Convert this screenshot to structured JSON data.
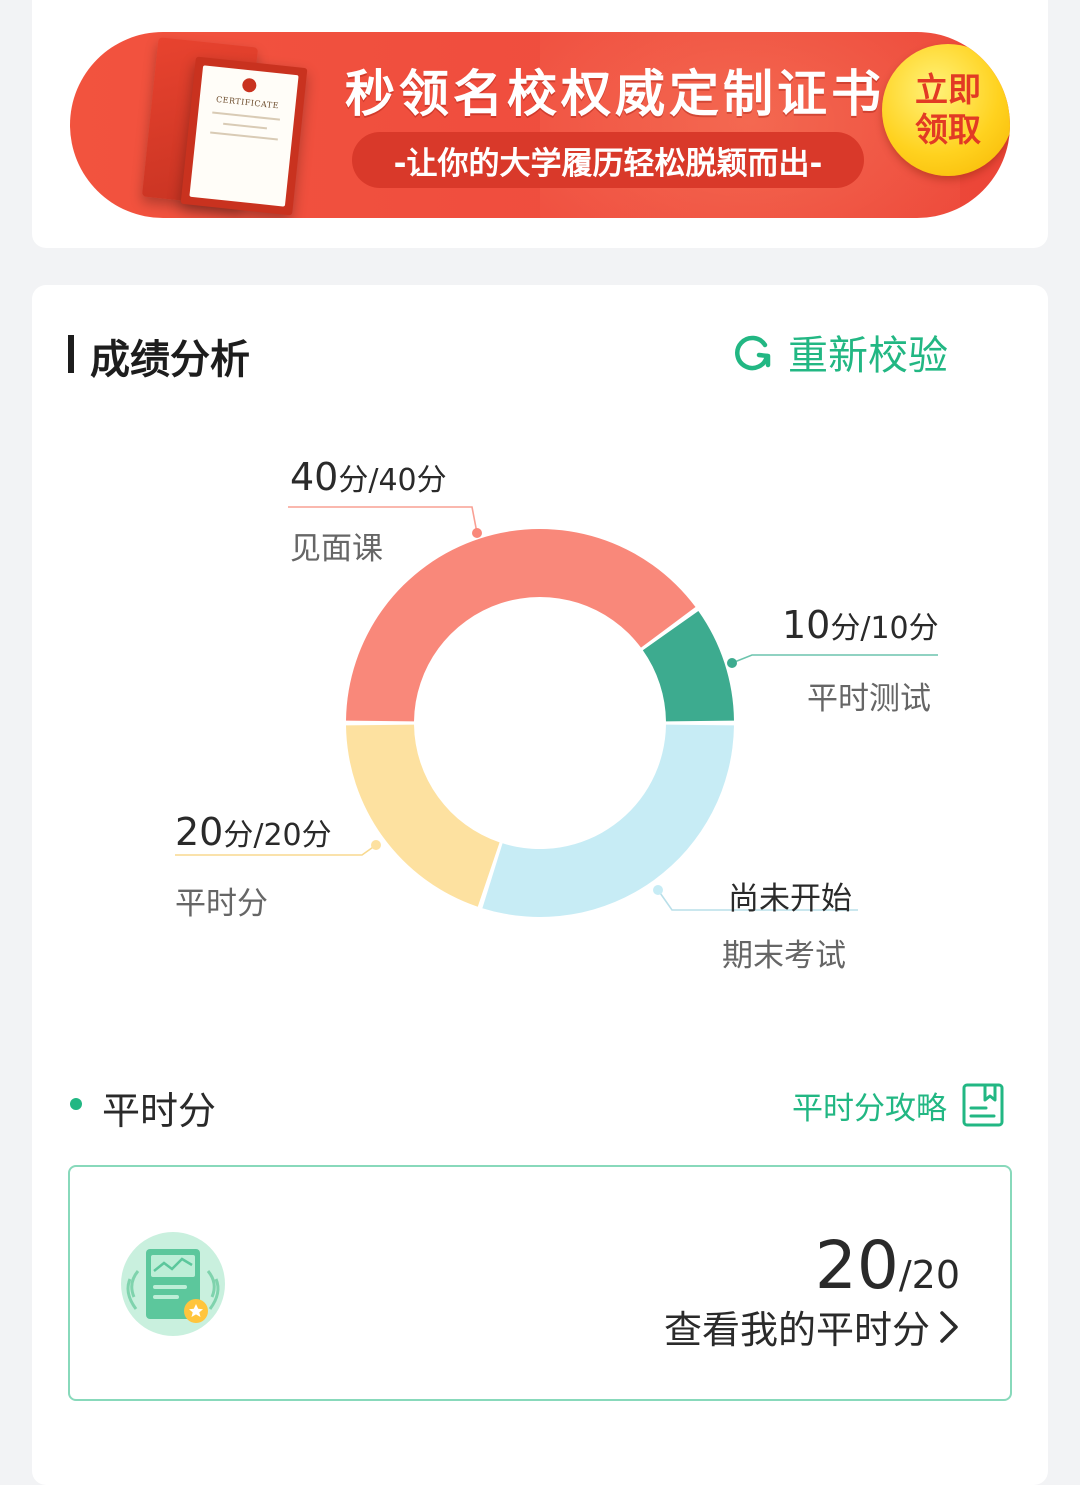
{
  "banner": {
    "title": "秒领名校权威定制证书",
    "subtitle": "-让你的大学履历轻松脱颖而出-",
    "claim_line1": "立即",
    "claim_line2": "领取",
    "certificate_text": "CERTIFICATE"
  },
  "score_section": {
    "title": "成绩分析",
    "reverify_label": "重新校验",
    "colors": {
      "accent": "#22b783",
      "face_to_face": "#f9887a",
      "quiz": "#3dab8f",
      "final_exam": "#c7ecf5",
      "regular": "#fde1a0"
    }
  },
  "chart_data": {
    "type": "pie",
    "slices": [
      {
        "name": "见面课",
        "score": 40,
        "max": 40,
        "value_text": "40",
        "unit1": "分",
        "max_text": "/40",
        "unit2": "分"
      },
      {
        "name": "平时测试",
        "score": 10,
        "max": 10,
        "value_text": "10",
        "unit1": "分",
        "max_text": "/10",
        "unit2": "分"
      },
      {
        "name": "期末考试",
        "score": 0,
        "max": 30,
        "status_text": "尚未开始"
      },
      {
        "name": "平时分",
        "score": 20,
        "max": 20,
        "value_text": "20",
        "unit1": "分",
        "max_text": "/20",
        "unit2": "分"
      }
    ]
  },
  "regular_score": {
    "title": "平时分",
    "strategy_label": "平时分攻略",
    "score": "20",
    "total": "/20",
    "view_label": "查看我的平时分"
  }
}
